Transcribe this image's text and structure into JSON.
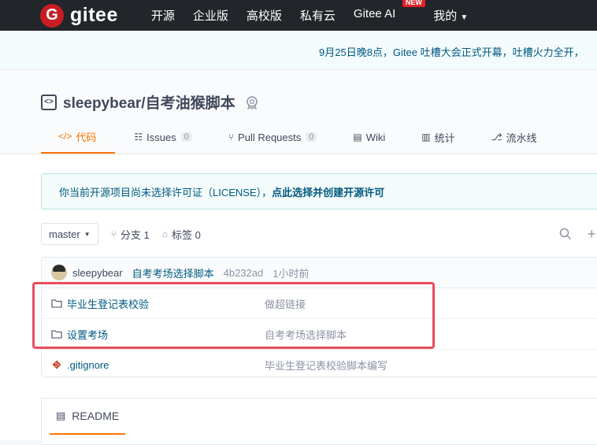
{
  "nav": {
    "logo_letter": "G",
    "logo_text": "gitee",
    "items": [
      "开源",
      "企业版",
      "高校版",
      "私有云"
    ],
    "ai_label": "Gitee AI",
    "ai_badge": "NEW",
    "mine_label": "我的"
  },
  "announcement": "9月25日晚8点，Gitee 吐槽大会正式开幕，吐槽火力全开，",
  "repo": {
    "name": "sleepybear/自考油猴脚本",
    "tabs": [
      {
        "label": "代码",
        "icon": "code-icon",
        "active": true
      },
      {
        "label": "Issues",
        "count": "0",
        "icon": "issues-icon"
      },
      {
        "label": "Pull Requests",
        "count": "0",
        "icon": "pull-request-icon"
      },
      {
        "label": "Wiki",
        "icon": "book-icon"
      },
      {
        "label": "统计",
        "icon": "bar-chart-icon"
      },
      {
        "label": "流水线",
        "icon": "pipeline-icon"
      }
    ]
  },
  "license": {
    "text": "你当前开源项目尚未选择许可证（LICENSE），",
    "link": "点此选择并创建开源许可"
  },
  "toolbar": {
    "branch": "master",
    "branches": "分支 1",
    "tags": "标签 0"
  },
  "commit": {
    "author": "sleepybear",
    "message": "自考考场选择脚本",
    "sha": "4b232ad",
    "time": "1小时前"
  },
  "files": [
    {
      "name": "毕业生登记表校验",
      "type": "folder",
      "desc": "做超链接"
    },
    {
      "name": "设置考场",
      "type": "folder",
      "desc": "自考考场选择脚本"
    },
    {
      "name": ".gitignore",
      "type": "git",
      "desc": "毕业生登记表校验脚本编写"
    }
  ],
  "readme": {
    "label": "README"
  },
  "colors": {
    "accent": "#fe7300",
    "nav_bg": "#22252a",
    "link": "#005980",
    "highlight": "#ea4c5b"
  }
}
